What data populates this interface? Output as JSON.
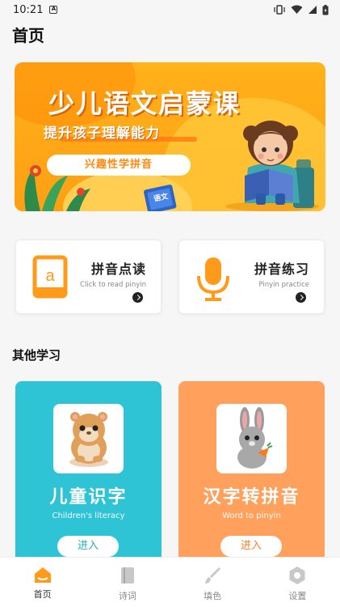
{
  "status": {
    "time": "10:21"
  },
  "header": {
    "title": "首页"
  },
  "banner": {
    "title": "少儿语文启蒙课",
    "subtitle": "提升孩子理解能力",
    "pill": "兴趣性学拼音",
    "book_label": "语文"
  },
  "quick_cards": [
    {
      "title": "拼音点读",
      "subtitle": "Click to read pinyin",
      "icon": "book-a-icon"
    },
    {
      "title": "拼音练习",
      "subtitle": "Pinyin practice",
      "icon": "microphone-icon"
    }
  ],
  "section": {
    "title": "其他学习"
  },
  "learn_cards": [
    {
      "title": "儿童识字",
      "subtitle": "Children's literacy",
      "button": "进入",
      "color": "#2fc3d6",
      "image": "hamster-toy"
    },
    {
      "title": "汉字转拼音",
      "subtitle": "Word to pinyin",
      "button": "进入",
      "color": "#ffa05c",
      "image": "rabbit-toy"
    }
  ],
  "tabbar": {
    "items": [
      {
        "label": "首页",
        "icon": "home-icon",
        "active": true
      },
      {
        "label": "诗词",
        "icon": "book-icon",
        "active": false
      },
      {
        "label": "填色",
        "icon": "brush-icon",
        "active": false
      },
      {
        "label": "设置",
        "icon": "settings-icon",
        "active": false
      }
    ]
  },
  "colors": {
    "accent": "#ff9a1a",
    "cyan": "#2fc3d6",
    "peach": "#ffa05c"
  }
}
